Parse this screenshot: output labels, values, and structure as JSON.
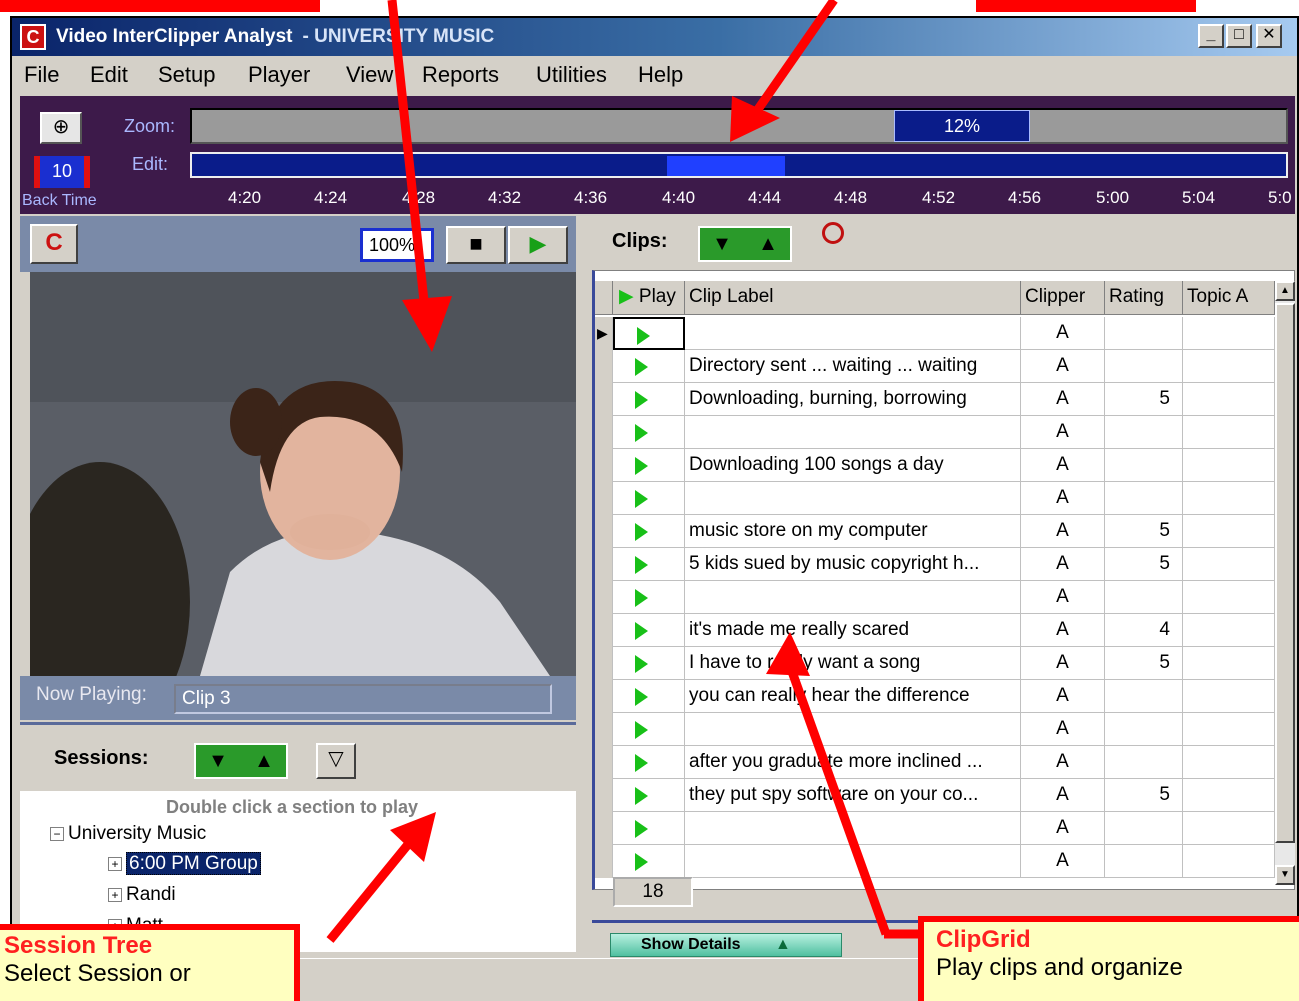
{
  "window": {
    "app_title": "Video InterClipper Analyst",
    "project_title": "- UNIVERSITY MUSIC",
    "min_label": "_",
    "max_label": "□",
    "close_label": "✕"
  },
  "menu": [
    "File",
    "Edit",
    "Setup",
    "Player",
    "View",
    "Reports",
    "Utilities",
    "Help"
  ],
  "timeline": {
    "zoom_label": "Zoom:",
    "edit_label": "Edit:",
    "zoom_percent": "12%",
    "back_time_value": "10",
    "back_time_label": "Back Time",
    "ticks": [
      "4:20",
      "4:24",
      "4:28",
      "4:32",
      "4:36",
      "4:40",
      "4:44",
      "4:48",
      "4:52",
      "4:56",
      "5:00",
      "5:04",
      "5:0"
    ]
  },
  "player": {
    "zoom_value": "100%",
    "now_playing_label": "Now Playing:",
    "now_playing_value": "Clip 3"
  },
  "sessions": {
    "title": "Sessions:",
    "hint": "Double click a section to play",
    "tree": [
      {
        "label": "University Music",
        "expander": "−"
      },
      {
        "label": "6:00 PM Group",
        "expander": "+",
        "selected": true
      },
      {
        "label": "Randi",
        "expander": "+"
      },
      {
        "label": "Matt",
        "expander": "+"
      }
    ]
  },
  "clips": {
    "title": "Clips:",
    "columns": [
      "Play",
      "Clip Label",
      "Clipper",
      "Rating",
      "Topic A"
    ],
    "rows": [
      {
        "label": "",
        "clipper": "A",
        "rating": ""
      },
      {
        "label": "Directory sent ... waiting ... waiting",
        "clipper": "A",
        "rating": ""
      },
      {
        "label": "Downloading, burning, borrowing",
        "clipper": "A",
        "rating": "5"
      },
      {
        "label": "",
        "clipper": "A",
        "rating": ""
      },
      {
        "label": "Downloading 100 songs a day",
        "clipper": "A",
        "rating": ""
      },
      {
        "label": "",
        "clipper": "A",
        "rating": ""
      },
      {
        "label": "music store on my computer",
        "clipper": "A",
        "rating": "5"
      },
      {
        "label": "5 kids sued  by music copyright h...",
        "clipper": "A",
        "rating": "5"
      },
      {
        "label": "",
        "clipper": "A",
        "rating": ""
      },
      {
        "label": "it's made me really scared",
        "clipper": "A",
        "rating": "4"
      },
      {
        "label": "I have to really want a song",
        "clipper": "A",
        "rating": "5"
      },
      {
        "label": "you can really hear the difference",
        "clipper": "A",
        "rating": ""
      },
      {
        "label": "",
        "clipper": "A",
        "rating": ""
      },
      {
        "label": "after you graduate more inclined ...",
        "clipper": "A",
        "rating": ""
      },
      {
        "label": "they put spy software on your co...",
        "clipper": "A",
        "rating": "5"
      },
      {
        "label": "",
        "clipper": "A",
        "rating": ""
      },
      {
        "label": "",
        "clipper": "A",
        "rating": ""
      }
    ],
    "count": "18",
    "show_details": "Show Details"
  },
  "callouts": {
    "session_tree_title": "Session Tree",
    "session_tree_text": "Select Session or",
    "clipgrid_title": "ClipGrid",
    "clipgrid_text": "Play clips and organize"
  }
}
